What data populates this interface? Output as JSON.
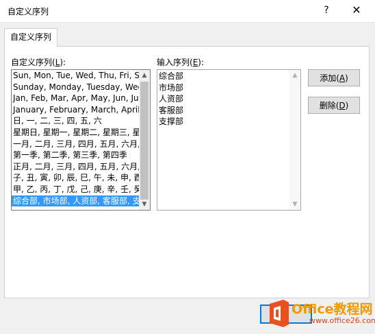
{
  "window": {
    "title": "自定义序列",
    "help_glyph": "?",
    "close_glyph": "✕"
  },
  "tabs": [
    {
      "label": "自定义序列"
    }
  ],
  "left_label": {
    "text": "自定义序列(",
    "accel": "L",
    "suffix": "):"
  },
  "right_label": {
    "text": "输入序列(",
    "accel": "E",
    "suffix": "):"
  },
  "custom_lists": [
    "Sun, Mon, Tue, Wed, Thu, Fri, S",
    "Sunday, Monday, Tuesday, Wed",
    "Jan, Feb, Mar, Apr, May, Jun, Ju",
    "January, February, March, April,",
    "日, 一, 二, 三, 四, 五, 六",
    "星期日, 星期一, 星期二, 星期三, 星",
    "一月, 二月, 三月, 四月, 五月, 六月,",
    "第一季, 第二季, 第三季, 第四季",
    "正月, 二月, 三月, 四月, 五月, 六月,",
    "子, 丑, 寅, 卯, 辰, 巳, 午, 未, 申, 酉",
    "甲, 乙, 丙, 丁, 戊, 己, 庚, 辛, 壬, 癸",
    "综合部, 市场部, 人资部, 客服部, 支"
  ],
  "selected_index": 11,
  "entries": [
    "综合部",
    "市场部",
    "人资部",
    "客服部",
    "支撑部"
  ],
  "buttons": {
    "add": {
      "text": "添加(",
      "accel": "A",
      "suffix": ")"
    },
    "delete": {
      "text": "删除(",
      "accel": "D",
      "suffix": ")"
    }
  },
  "watermark": {
    "title": "Office教程网",
    "subtitle": "www.office26.com"
  },
  "colors": {
    "selection": "#3399ff",
    "watermark_orange": "#f39800",
    "focus_border": "#0078d7"
  },
  "icons": {
    "help": "help-icon",
    "close": "close-icon",
    "scroll_up": "scroll-up-arrow-icon",
    "scroll_down": "scroll-down-arrow-icon"
  }
}
